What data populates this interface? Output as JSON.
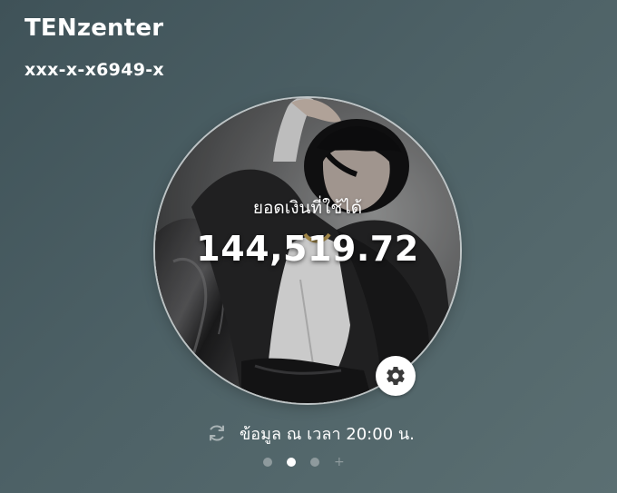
{
  "account": {
    "name": "TENzenter",
    "number": "xxx-x-x6949-x"
  },
  "balance": {
    "label": "ยอดเงินที่ใช้ได้",
    "amount": "144,519.72"
  },
  "update": {
    "text": "ข้อมูล ณ เวลา 20:00 น."
  },
  "pager": {
    "page_count": 3,
    "active_index": 1,
    "add_symbol": "+"
  },
  "icons": {
    "settings": "gear-icon",
    "refresh": "refresh-icon"
  },
  "colors": {
    "background": "#4d6166",
    "text": "#ffffff",
    "inactive_dot": "#8e9a9d"
  }
}
